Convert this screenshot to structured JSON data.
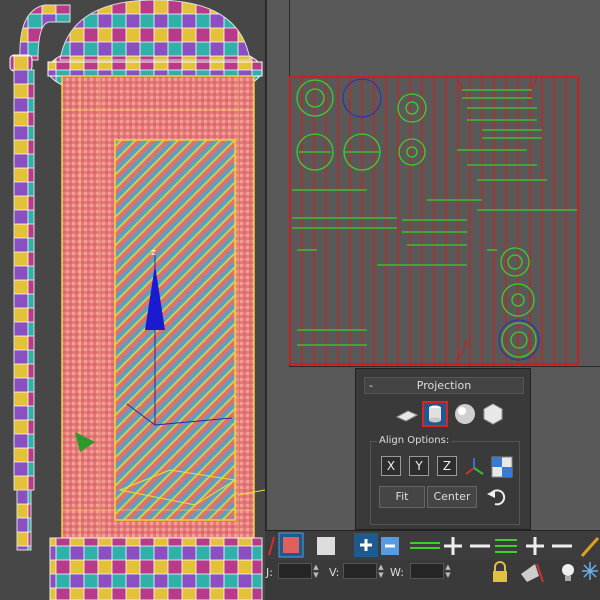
{
  "projection_rollout": {
    "collapse_symbol": "-",
    "title": "Projection",
    "buttons": [
      {
        "icon": "planar-map-icon",
        "active": false
      },
      {
        "icon": "cylindrical-map-icon",
        "active": true
      },
      {
        "icon": "spherical-map-icon",
        "active": false
      },
      {
        "icon": "box-map-icon",
        "active": false
      }
    ]
  },
  "align_options": {
    "label": "Align Options:",
    "x_label": "X",
    "y_label": "Y",
    "z_label": "Z",
    "fit_label": "Fit",
    "center_label": "Center"
  },
  "status": {
    "u_label": "J:",
    "v_label": "V:",
    "w_label": "W:",
    "u_value": "",
    "v_value": "",
    "w_value": ""
  },
  "viewport": {
    "gizmo_axis_label": "z"
  },
  "colors": {
    "selection_red": "#cc1f1f",
    "uv_green": "#3ecf2a",
    "active_blue": "#1f5a8f"
  }
}
